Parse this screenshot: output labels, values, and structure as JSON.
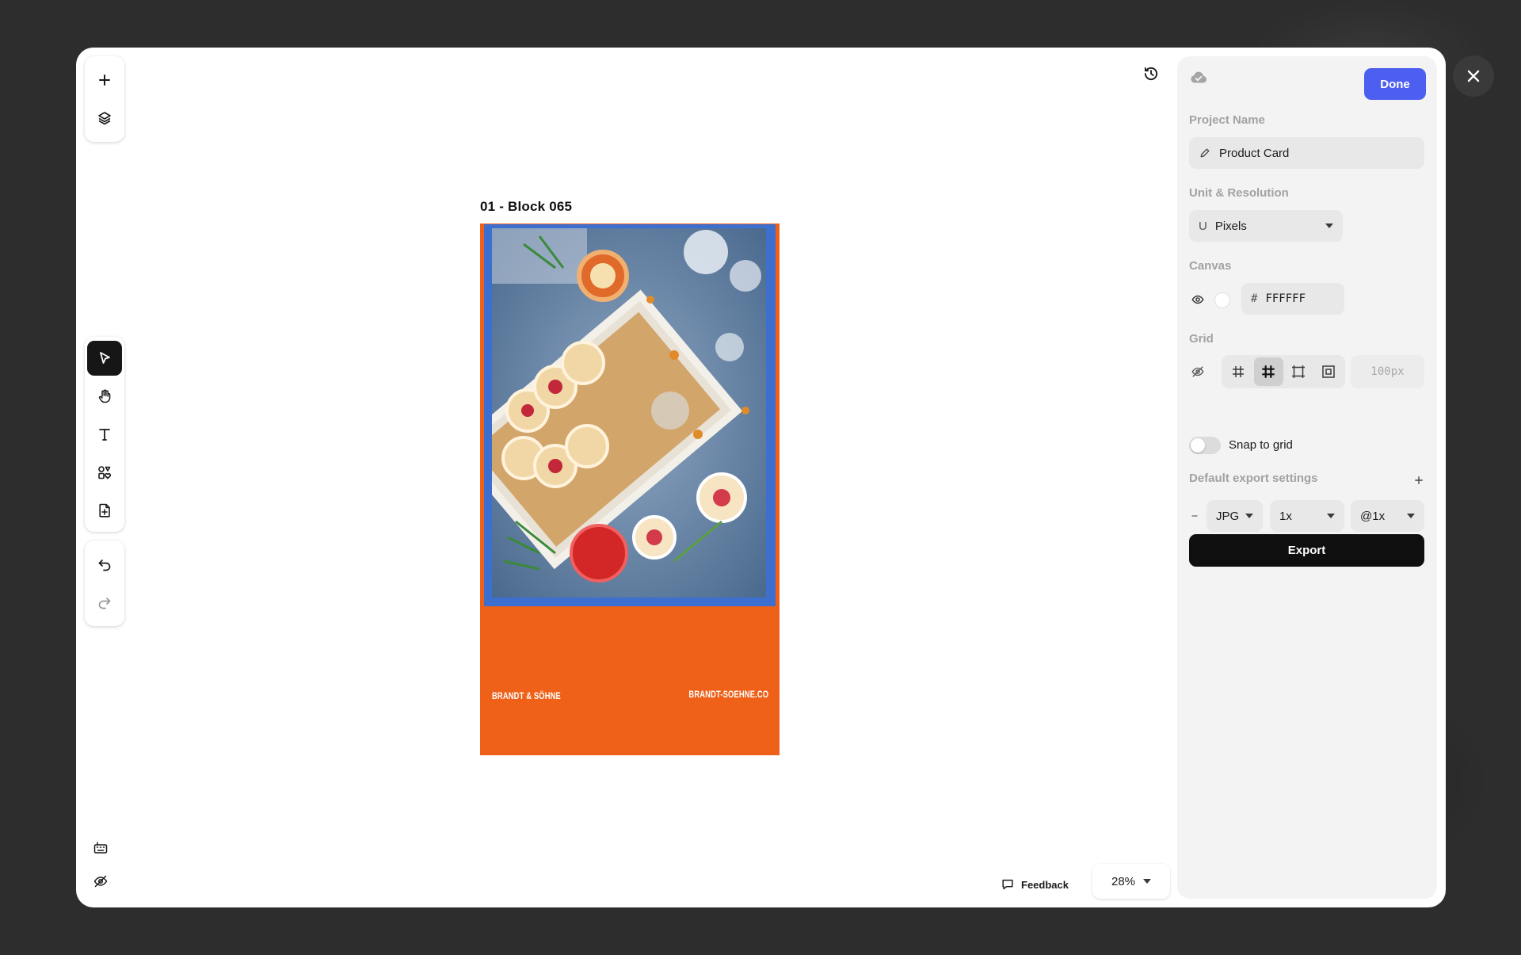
{
  "artboard": {
    "title": "01 - Block 065",
    "brand_left": "BRANDT & SÖHNE",
    "brand_right": "BRANDT-SOEHNE.CO"
  },
  "footer": {
    "feedback_label": "Feedback",
    "zoom_value": "28%"
  },
  "panel": {
    "done_label": "Done",
    "project_name_label": "Project Name",
    "project_name_value": "Product Card",
    "unit_label": "Unit & Resolution",
    "unit_prefix": "U",
    "unit_value": "Pixels",
    "canvas_label": "Canvas",
    "canvas_hash": "#",
    "canvas_color": "FFFFFF",
    "grid_label": "Grid",
    "grid_size": "100px",
    "snap_label": "Snap to grid",
    "export_settings_label": "Default export settings",
    "export_format": "JPG",
    "export_scale": "1x",
    "export_density": "@1x",
    "export_label": "Export"
  },
  "colors": {
    "accent": "#4d5ff0",
    "artboard_orange": "#ef6119",
    "photo_frame_blue": "#3d6fd0"
  }
}
